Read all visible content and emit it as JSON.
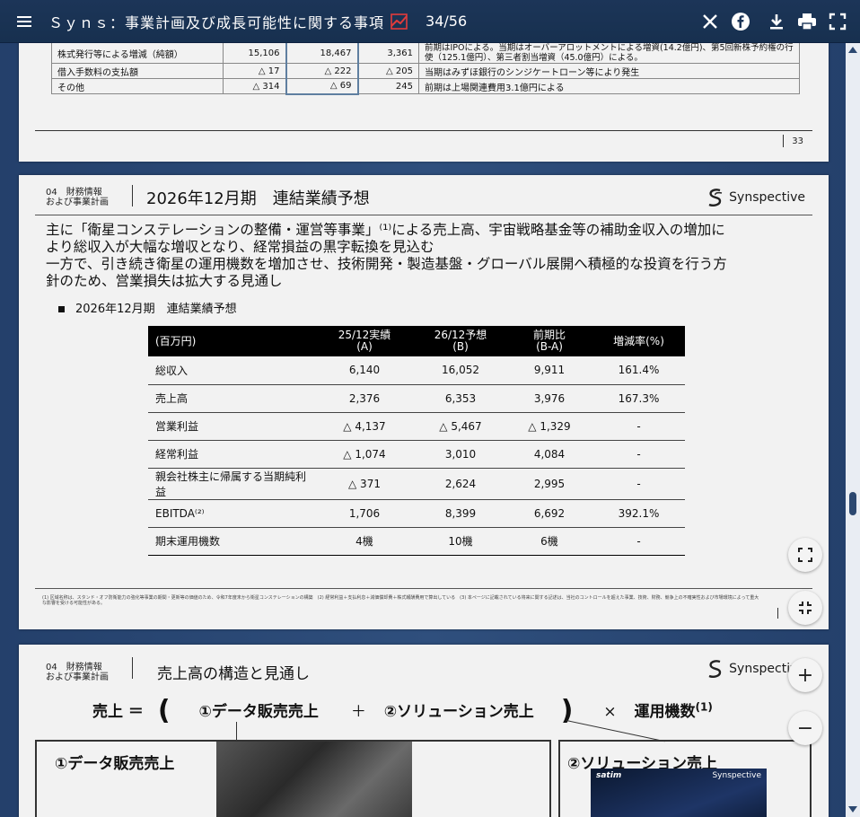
{
  "header": {
    "title": "Ｓｙｎｓ：事業計画及び成長可能性に関する事項",
    "page_indicator": "34/56",
    "icons": [
      "menu-icon",
      "trend-icon",
      "x-icon",
      "facebook-icon",
      "download-icon",
      "print-icon",
      "fullscreen-icon"
    ]
  },
  "page_prev": {
    "rows": [
      {
        "label": "株式発行等による増減（純額）",
        "a": "15,106",
        "b": "18,467",
        "c": "3,361",
        "note": "前期はIPOによる。当期はオーバーアロットメントによる増資(14.2億円)、第5回新株予約権の行使（125.1億円）、第三者割当増資（45.0億円）による。"
      },
      {
        "label": "借入手数料の支払額",
        "a": "△ 17",
        "b": "△ 222",
        "c": "△ 205",
        "note": "当期はみずほ銀行のシンジケートローン等により発生"
      },
      {
        "label": "その他",
        "a": "△ 314",
        "b": "△ 69",
        "c": "245",
        "note": "前期は上場関連費用3.1億円による"
      }
    ],
    "page_number": "33"
  },
  "page_main": {
    "section_line1": "04　財務情報",
    "section_line2": "および事業計画",
    "title": "2026年12月期　連結業績予想",
    "logo_text": "Synspective",
    "lead_line1": "主に「衛星コンステレーションの整備・運営等事業」⁽¹⁾による売上高、宇宙戦略基金等の補助金収入の増加に",
    "lead_line2": "より総収入が大幅な増収となり、経常損益の黒字転換を見込む",
    "lead_line3": "一方で、引き続き衛星の運用機数を増加させ、技術開発・製造基盤・グローバル展開へ積極的な投資を行う方",
    "lead_line4": "針のため、営業損失は拡大する見通し",
    "subheading": "2026年12月期　連結業績予想",
    "table": {
      "headers": [
        "(百万円)",
        "25/12実績\n(A)",
        "26/12予想\n(B)",
        "前期比\n(B-A)",
        "増減率(%)"
      ],
      "rows": [
        {
          "label": "総収入",
          "a": "6,140",
          "b": "16,052",
          "c": "9,911",
          "d": "161.4%"
        },
        {
          "label": "売上高",
          "a": "2,376",
          "b": "6,353",
          "c": "3,976",
          "d": "167.3%"
        },
        {
          "label": "営業利益",
          "a": "△ 4,137",
          "b": "△ 5,467",
          "c": "△ 1,329",
          "d": "-"
        },
        {
          "label": "経常利益",
          "a": "△ 1,074",
          "b": "3,010",
          "c": "4,084",
          "d": "-"
        },
        {
          "label": "親会社株主に帰属する当期純利益",
          "a": "△ 371",
          "b": "2,624",
          "c": "2,995",
          "d": "-"
        },
        {
          "label": "EBITDA⁽²⁾",
          "a": "1,706",
          "b": "8,399",
          "c": "6,692",
          "d": "392.1%"
        },
        {
          "label": "期末運用機数",
          "a": "4機",
          "b": "10機",
          "c": "6機",
          "d": "-"
        }
      ]
    },
    "notes": "(1) 区域名称は、スタンド・オフ防衛能力の強化等事業の期間・更新等の価値のため、令和7年度末から衛星コンステレーションの構築　(2) 経常利益＋支払利息＋減価償却費＋株式報酬費用で算出している　(3) 本ページに記載されている将来に関する記述は、当社のコントロールを超えた事業、技術、財務、競争上の不確実性および市場環境によって重大な影響を受ける可能性がある。"
  },
  "page_next": {
    "section_line1": "04　財務情報",
    "section_line2": "および事業計画",
    "title": "売上高の構造と見通し",
    "logo_text": "Synspective",
    "formula_left": "売上 ＝",
    "paren_open": "(",
    "term1": "①データ販売売上",
    "plus": "＋",
    "term2": "②ソリューション売上",
    "paren_close": ")",
    "times": "×",
    "term3": "運用機数",
    "term3_sup": "(1)",
    "box1_title": "①データ販売売上",
    "box2_title": "②ソリューション売上",
    "sat_logo": "satim",
    "sat_logo2": "Synspective"
  },
  "controls": {
    "expand": "expand-icon",
    "shrink": "shrink-icon",
    "zoom_in": "+",
    "zoom_out": "−"
  }
}
